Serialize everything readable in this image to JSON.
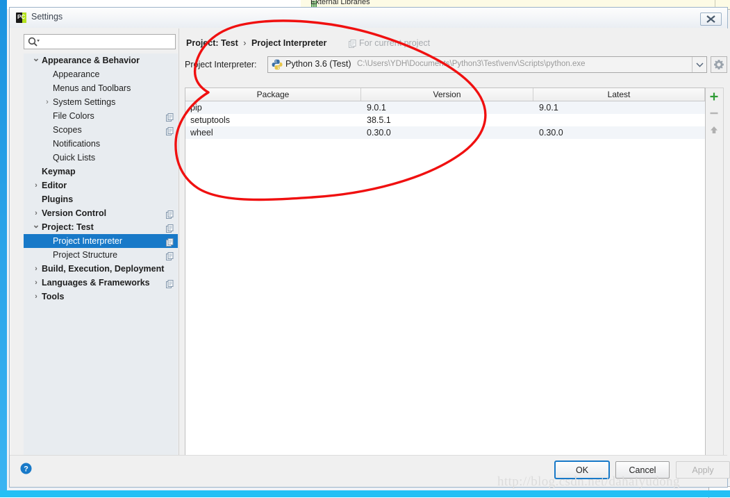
{
  "backdrop": {
    "tree_label": "External Libraries"
  },
  "window": {
    "title": "Settings",
    "icon": "pycharm-icon",
    "close_label": "close"
  },
  "search": {
    "value": "",
    "placeholder": "",
    "icon": "search-icon"
  },
  "sidebar": {
    "items": [
      {
        "label": "Appearance & Behavior",
        "indent": 26,
        "arrow": "v",
        "bold": true,
        "copy": false,
        "selected": false
      },
      {
        "label": "Appearance",
        "indent": 42,
        "arrow": "",
        "bold": false,
        "copy": false,
        "selected": false
      },
      {
        "label": "Menus and Toolbars",
        "indent": 42,
        "arrow": "",
        "bold": false,
        "copy": false,
        "selected": false
      },
      {
        "label": "System Settings",
        "indent": 42,
        "arrow": ">",
        "bold": false,
        "copy": false,
        "selected": false
      },
      {
        "label": "File Colors",
        "indent": 42,
        "arrow": "",
        "bold": false,
        "copy": true,
        "selected": false
      },
      {
        "label": "Scopes",
        "indent": 42,
        "arrow": "",
        "bold": false,
        "copy": true,
        "selected": false
      },
      {
        "label": "Notifications",
        "indent": 42,
        "arrow": "",
        "bold": false,
        "copy": false,
        "selected": false
      },
      {
        "label": "Quick Lists",
        "indent": 42,
        "arrow": "",
        "bold": false,
        "copy": false,
        "selected": false
      },
      {
        "label": "Keymap",
        "indent": 26,
        "arrow": "",
        "bold": true,
        "copy": false,
        "selected": false
      },
      {
        "label": "Editor",
        "indent": 26,
        "arrow": ">",
        "bold": true,
        "copy": false,
        "selected": false
      },
      {
        "label": "Plugins",
        "indent": 26,
        "arrow": "",
        "bold": true,
        "copy": false,
        "selected": false
      },
      {
        "label": "Version Control",
        "indent": 26,
        "arrow": ">",
        "bold": true,
        "copy": true,
        "selected": false
      },
      {
        "label": "Project: Test",
        "indent": 26,
        "arrow": "v",
        "bold": true,
        "copy": true,
        "selected": false
      },
      {
        "label": "Project Interpreter",
        "indent": 42,
        "arrow": "",
        "bold": false,
        "copy": true,
        "selected": true
      },
      {
        "label": "Project Structure",
        "indent": 42,
        "arrow": "",
        "bold": false,
        "copy": true,
        "selected": false
      },
      {
        "label": "Build, Execution, Deployment",
        "indent": 26,
        "arrow": ">",
        "bold": true,
        "copy": false,
        "selected": false
      },
      {
        "label": "Languages & Frameworks",
        "indent": 26,
        "arrow": ">",
        "bold": true,
        "copy": true,
        "selected": false
      },
      {
        "label": "Tools",
        "indent": 26,
        "arrow": ">",
        "bold": true,
        "copy": false,
        "selected": false
      }
    ]
  },
  "content": {
    "breadcrumb_root": "Project: Test",
    "breadcrumb_sep": "›",
    "breadcrumb_leaf": "Project Interpreter",
    "scope_note": "For current project",
    "scope_note_icon": "copy-icon",
    "interpreter_label": "Project Interpreter:",
    "interpreter_name": "Python 3.6 (Test)",
    "interpreter_path": "C:\\Users\\YDH\\Documents\\Python3\\Test\\venv\\Scripts\\python.exe",
    "interpreter_icon": "python-icon",
    "dropdown_icon": "chevron-down-icon",
    "gear_icon": "gear-icon"
  },
  "packages": {
    "columns": [
      "Package",
      "Version",
      "Latest"
    ],
    "rows": [
      {
        "package": "pip",
        "version": "9.0.1",
        "latest": "9.0.1"
      },
      {
        "package": "setuptools",
        "version": "38.5.1",
        "latest": ""
      },
      {
        "package": "wheel",
        "version": "0.30.0",
        "latest": "0.30.0"
      }
    ]
  },
  "table_toolbar": {
    "add_icon": "plus-icon",
    "remove_icon": "minus-icon",
    "upgrade_icon": "arrow-up-icon",
    "add_color": "#2e9b35",
    "remove_color": "#b4b4b4",
    "upgrade_color": "#b0b0b0"
  },
  "footer": {
    "help_icon": "help-icon",
    "ok_label": "OK",
    "cancel_label": "Cancel",
    "apply_label": "Apply"
  },
  "watermark": {
    "text": "http://blog.csdn.net/dahaiyudong"
  },
  "annotation": {
    "color": "#f01010",
    "shape": "hand-drawn-ellipse"
  }
}
